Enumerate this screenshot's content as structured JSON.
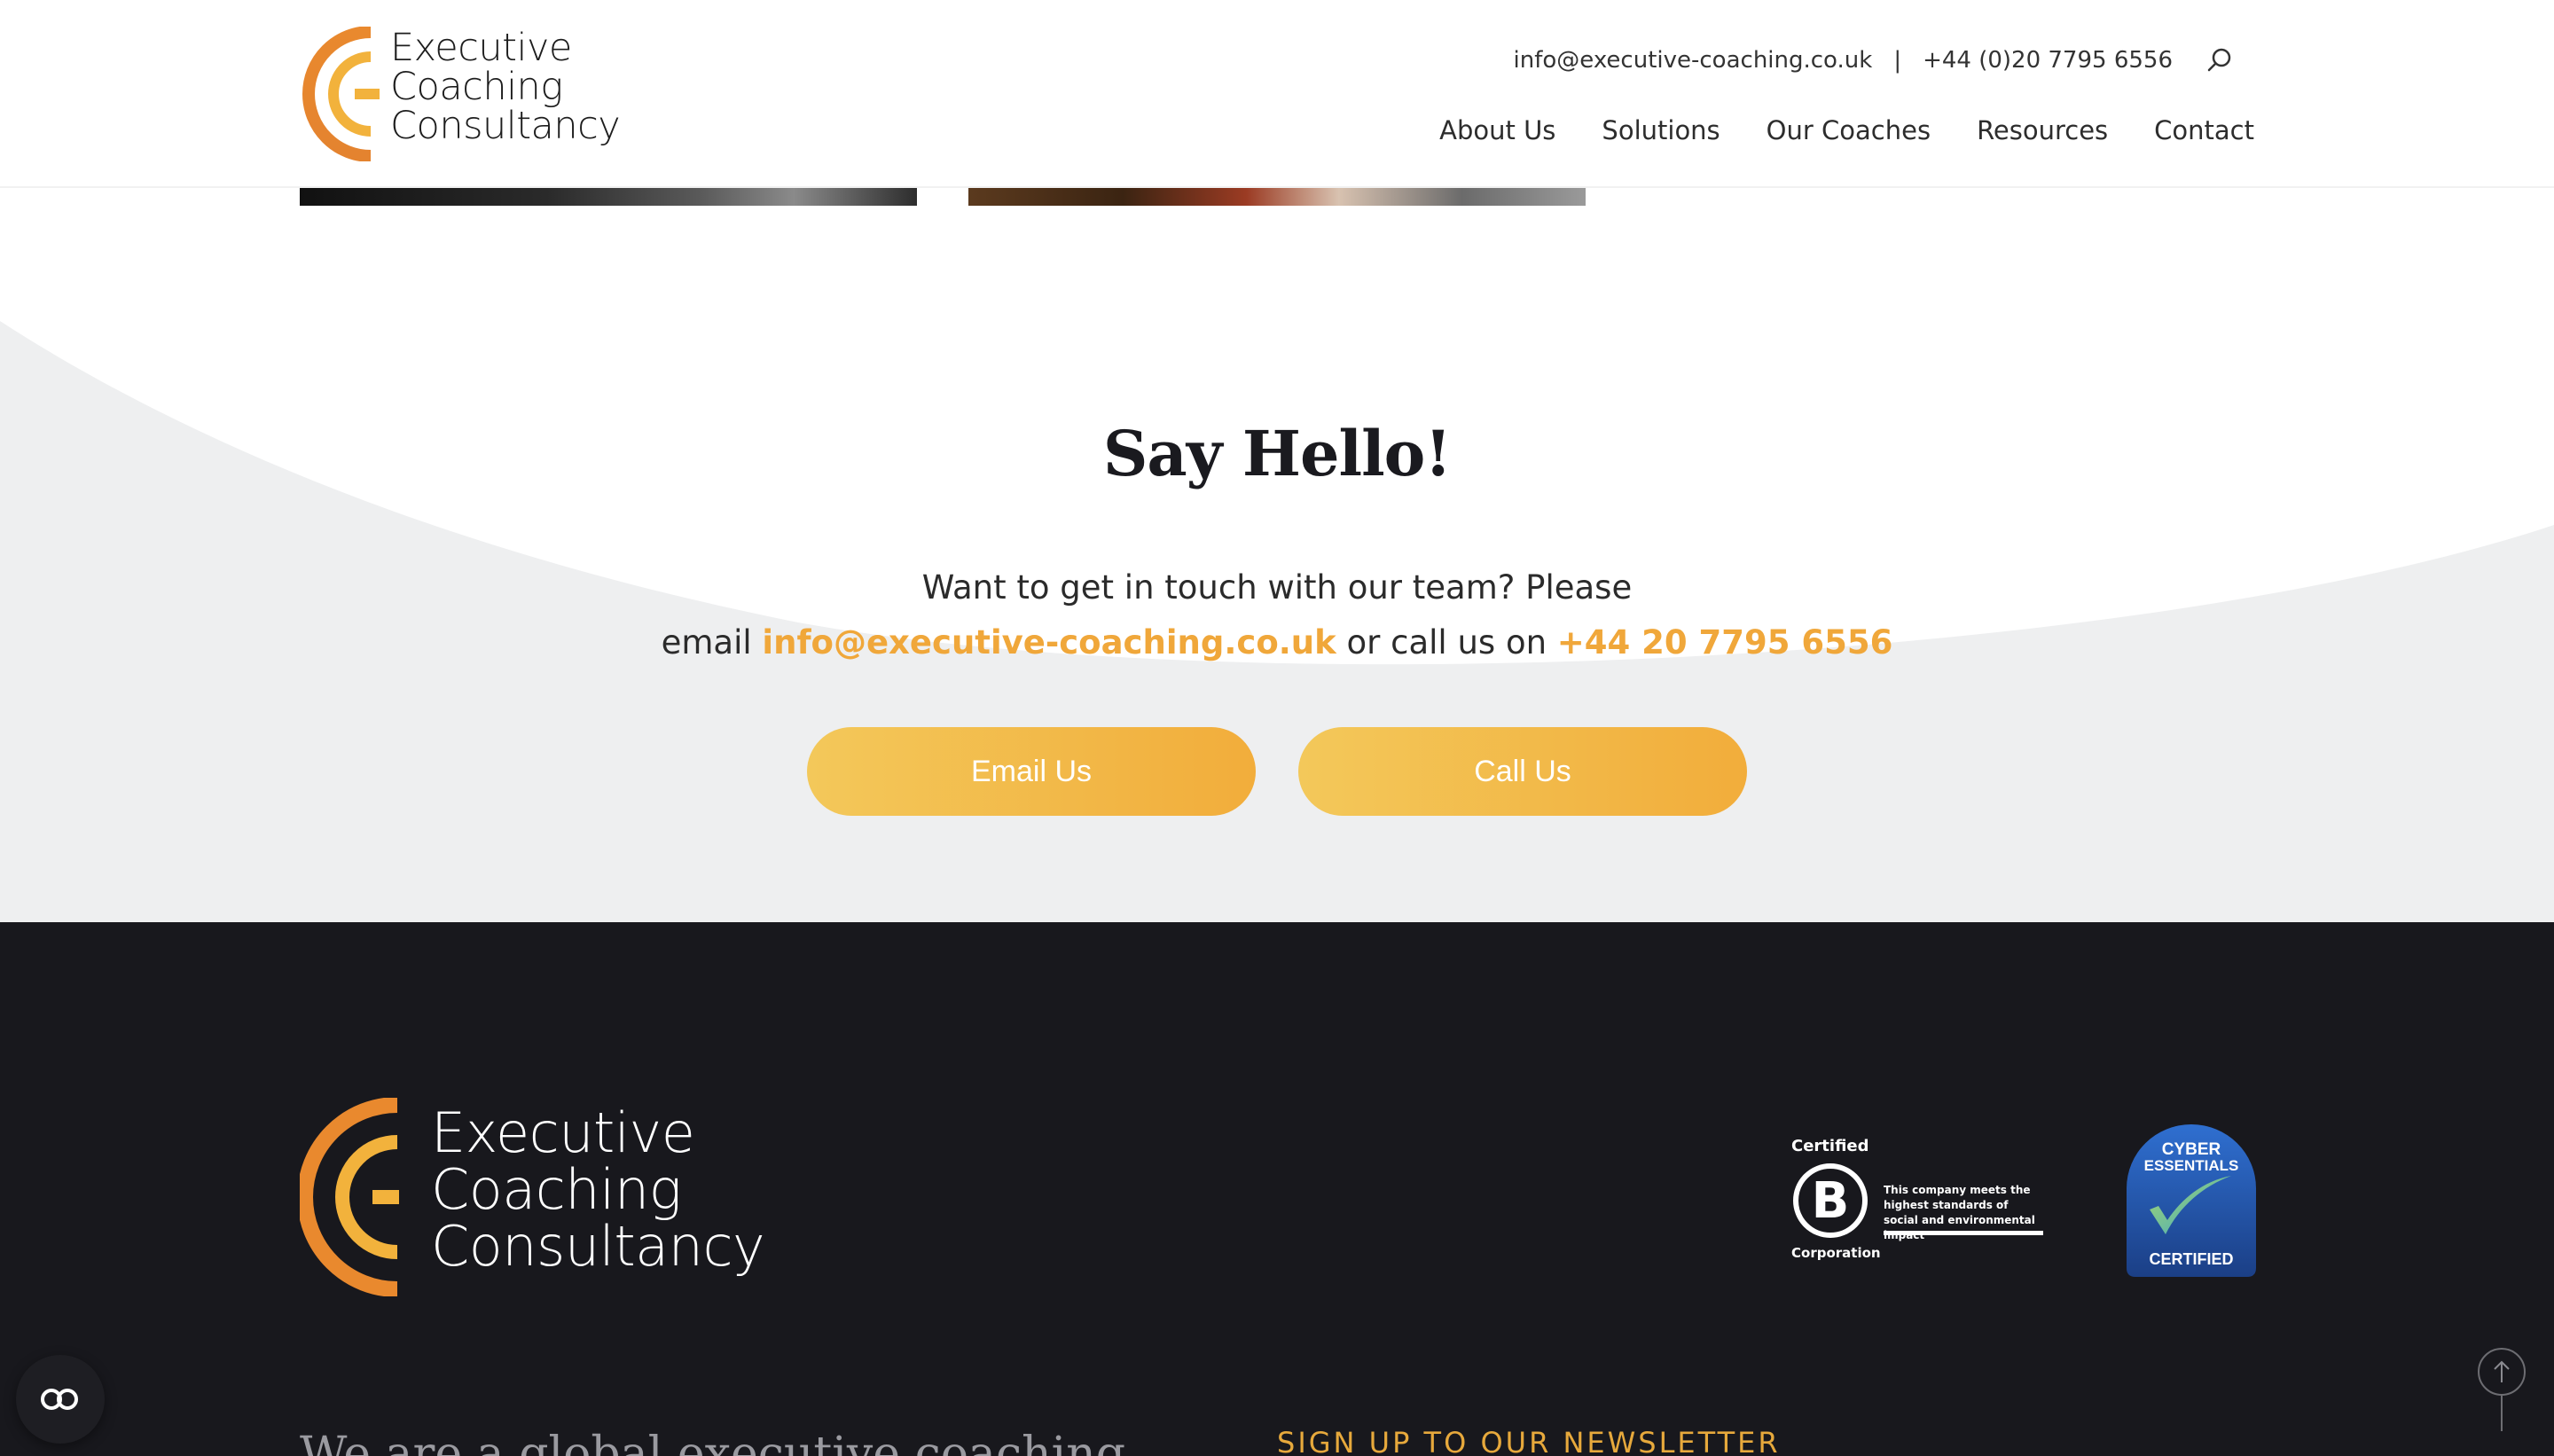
{
  "header": {
    "logo_lines": [
      "Executive",
      "Coaching",
      "Consultancy"
    ],
    "email": "info@executive-coaching.co.uk",
    "separator": "|",
    "phone": "+44 (0)20 7795 6556",
    "search_icon": "search-icon",
    "nav": [
      "About Us",
      "Solutions",
      "Our Coaches",
      "Resources",
      "Contact"
    ]
  },
  "hello": {
    "title": "Say Hello!",
    "line1": "Want to get in touch with our team? Please",
    "line2_prefix": "email ",
    "email": "info@executive-coaching.co.uk",
    "line2_middle": " or call us on ",
    "phone": "+44 20 7795 6556",
    "email_button": "Email Us",
    "call_button": "Call Us"
  },
  "footer": {
    "logo_lines": [
      "Executive",
      "Coaching",
      "Consultancy"
    ],
    "bcorp": {
      "certified": "Certified",
      "letter": "B",
      "corporation": "Corporation",
      "description": "This company meets the highest standards of social and environmental impact"
    },
    "cyber": {
      "line1": "CYBER",
      "line2": "ESSENTIALS",
      "certified": "CERTIFIED"
    },
    "tagline": "We are a global executive coaching",
    "newsletter": "SIGN UP TO OUR NEWSLETTER"
  },
  "colors": {
    "accent": "#f0a73a",
    "button_start": "#f3c85a",
    "button_end": "#f2ad3b",
    "footer_bg": "#18181d",
    "section_bg": "#eeeff0"
  },
  "widgets": {
    "cookie_icon": "cookie-settings-icon",
    "back_to_top_icon": "arrow-up-icon"
  }
}
